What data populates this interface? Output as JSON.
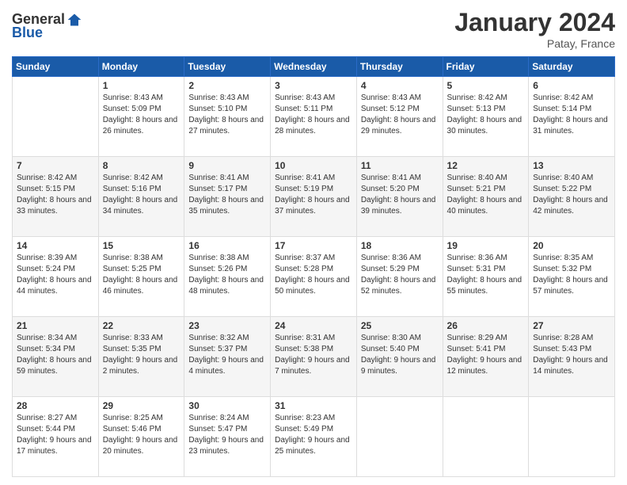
{
  "logo": {
    "text_general": "General",
    "text_blue": "Blue"
  },
  "title": "January 2024",
  "subtitle": "Patay, France",
  "days_of_week": [
    "Sunday",
    "Monday",
    "Tuesday",
    "Wednesday",
    "Thursday",
    "Friday",
    "Saturday"
  ],
  "weeks": [
    [
      {
        "day": "",
        "sunrise": "",
        "sunset": "",
        "daylight": ""
      },
      {
        "day": "1",
        "sunrise": "Sunrise: 8:43 AM",
        "sunset": "Sunset: 5:09 PM",
        "daylight": "Daylight: 8 hours and 26 minutes."
      },
      {
        "day": "2",
        "sunrise": "Sunrise: 8:43 AM",
        "sunset": "Sunset: 5:10 PM",
        "daylight": "Daylight: 8 hours and 27 minutes."
      },
      {
        "day": "3",
        "sunrise": "Sunrise: 8:43 AM",
        "sunset": "Sunset: 5:11 PM",
        "daylight": "Daylight: 8 hours and 28 minutes."
      },
      {
        "day": "4",
        "sunrise": "Sunrise: 8:43 AM",
        "sunset": "Sunset: 5:12 PM",
        "daylight": "Daylight: 8 hours and 29 minutes."
      },
      {
        "day": "5",
        "sunrise": "Sunrise: 8:42 AM",
        "sunset": "Sunset: 5:13 PM",
        "daylight": "Daylight: 8 hours and 30 minutes."
      },
      {
        "day": "6",
        "sunrise": "Sunrise: 8:42 AM",
        "sunset": "Sunset: 5:14 PM",
        "daylight": "Daylight: 8 hours and 31 minutes."
      }
    ],
    [
      {
        "day": "7",
        "sunrise": "Sunrise: 8:42 AM",
        "sunset": "Sunset: 5:15 PM",
        "daylight": "Daylight: 8 hours and 33 minutes."
      },
      {
        "day": "8",
        "sunrise": "Sunrise: 8:42 AM",
        "sunset": "Sunset: 5:16 PM",
        "daylight": "Daylight: 8 hours and 34 minutes."
      },
      {
        "day": "9",
        "sunrise": "Sunrise: 8:41 AM",
        "sunset": "Sunset: 5:17 PM",
        "daylight": "Daylight: 8 hours and 35 minutes."
      },
      {
        "day": "10",
        "sunrise": "Sunrise: 8:41 AM",
        "sunset": "Sunset: 5:19 PM",
        "daylight": "Daylight: 8 hours and 37 minutes."
      },
      {
        "day": "11",
        "sunrise": "Sunrise: 8:41 AM",
        "sunset": "Sunset: 5:20 PM",
        "daylight": "Daylight: 8 hours and 39 minutes."
      },
      {
        "day": "12",
        "sunrise": "Sunrise: 8:40 AM",
        "sunset": "Sunset: 5:21 PM",
        "daylight": "Daylight: 8 hours and 40 minutes."
      },
      {
        "day": "13",
        "sunrise": "Sunrise: 8:40 AM",
        "sunset": "Sunset: 5:22 PM",
        "daylight": "Daylight: 8 hours and 42 minutes."
      }
    ],
    [
      {
        "day": "14",
        "sunrise": "Sunrise: 8:39 AM",
        "sunset": "Sunset: 5:24 PM",
        "daylight": "Daylight: 8 hours and 44 minutes."
      },
      {
        "day": "15",
        "sunrise": "Sunrise: 8:38 AM",
        "sunset": "Sunset: 5:25 PM",
        "daylight": "Daylight: 8 hours and 46 minutes."
      },
      {
        "day": "16",
        "sunrise": "Sunrise: 8:38 AM",
        "sunset": "Sunset: 5:26 PM",
        "daylight": "Daylight: 8 hours and 48 minutes."
      },
      {
        "day": "17",
        "sunrise": "Sunrise: 8:37 AM",
        "sunset": "Sunset: 5:28 PM",
        "daylight": "Daylight: 8 hours and 50 minutes."
      },
      {
        "day": "18",
        "sunrise": "Sunrise: 8:36 AM",
        "sunset": "Sunset: 5:29 PM",
        "daylight": "Daylight: 8 hours and 52 minutes."
      },
      {
        "day": "19",
        "sunrise": "Sunrise: 8:36 AM",
        "sunset": "Sunset: 5:31 PM",
        "daylight": "Daylight: 8 hours and 55 minutes."
      },
      {
        "day": "20",
        "sunrise": "Sunrise: 8:35 AM",
        "sunset": "Sunset: 5:32 PM",
        "daylight": "Daylight: 8 hours and 57 minutes."
      }
    ],
    [
      {
        "day": "21",
        "sunrise": "Sunrise: 8:34 AM",
        "sunset": "Sunset: 5:34 PM",
        "daylight": "Daylight: 8 hours and 59 minutes."
      },
      {
        "day": "22",
        "sunrise": "Sunrise: 8:33 AM",
        "sunset": "Sunset: 5:35 PM",
        "daylight": "Daylight: 9 hours and 2 minutes."
      },
      {
        "day": "23",
        "sunrise": "Sunrise: 8:32 AM",
        "sunset": "Sunset: 5:37 PM",
        "daylight": "Daylight: 9 hours and 4 minutes."
      },
      {
        "day": "24",
        "sunrise": "Sunrise: 8:31 AM",
        "sunset": "Sunset: 5:38 PM",
        "daylight": "Daylight: 9 hours and 7 minutes."
      },
      {
        "day": "25",
        "sunrise": "Sunrise: 8:30 AM",
        "sunset": "Sunset: 5:40 PM",
        "daylight": "Daylight: 9 hours and 9 minutes."
      },
      {
        "day": "26",
        "sunrise": "Sunrise: 8:29 AM",
        "sunset": "Sunset: 5:41 PM",
        "daylight": "Daylight: 9 hours and 12 minutes."
      },
      {
        "day": "27",
        "sunrise": "Sunrise: 8:28 AM",
        "sunset": "Sunset: 5:43 PM",
        "daylight": "Daylight: 9 hours and 14 minutes."
      }
    ],
    [
      {
        "day": "28",
        "sunrise": "Sunrise: 8:27 AM",
        "sunset": "Sunset: 5:44 PM",
        "daylight": "Daylight: 9 hours and 17 minutes."
      },
      {
        "day": "29",
        "sunrise": "Sunrise: 8:25 AM",
        "sunset": "Sunset: 5:46 PM",
        "daylight": "Daylight: 9 hours and 20 minutes."
      },
      {
        "day": "30",
        "sunrise": "Sunrise: 8:24 AM",
        "sunset": "Sunset: 5:47 PM",
        "daylight": "Daylight: 9 hours and 23 minutes."
      },
      {
        "day": "31",
        "sunrise": "Sunrise: 8:23 AM",
        "sunset": "Sunset: 5:49 PM",
        "daylight": "Daylight: 9 hours and 25 minutes."
      },
      {
        "day": "",
        "sunrise": "",
        "sunset": "",
        "daylight": ""
      },
      {
        "day": "",
        "sunrise": "",
        "sunset": "",
        "daylight": ""
      },
      {
        "day": "",
        "sunrise": "",
        "sunset": "",
        "daylight": ""
      }
    ]
  ]
}
